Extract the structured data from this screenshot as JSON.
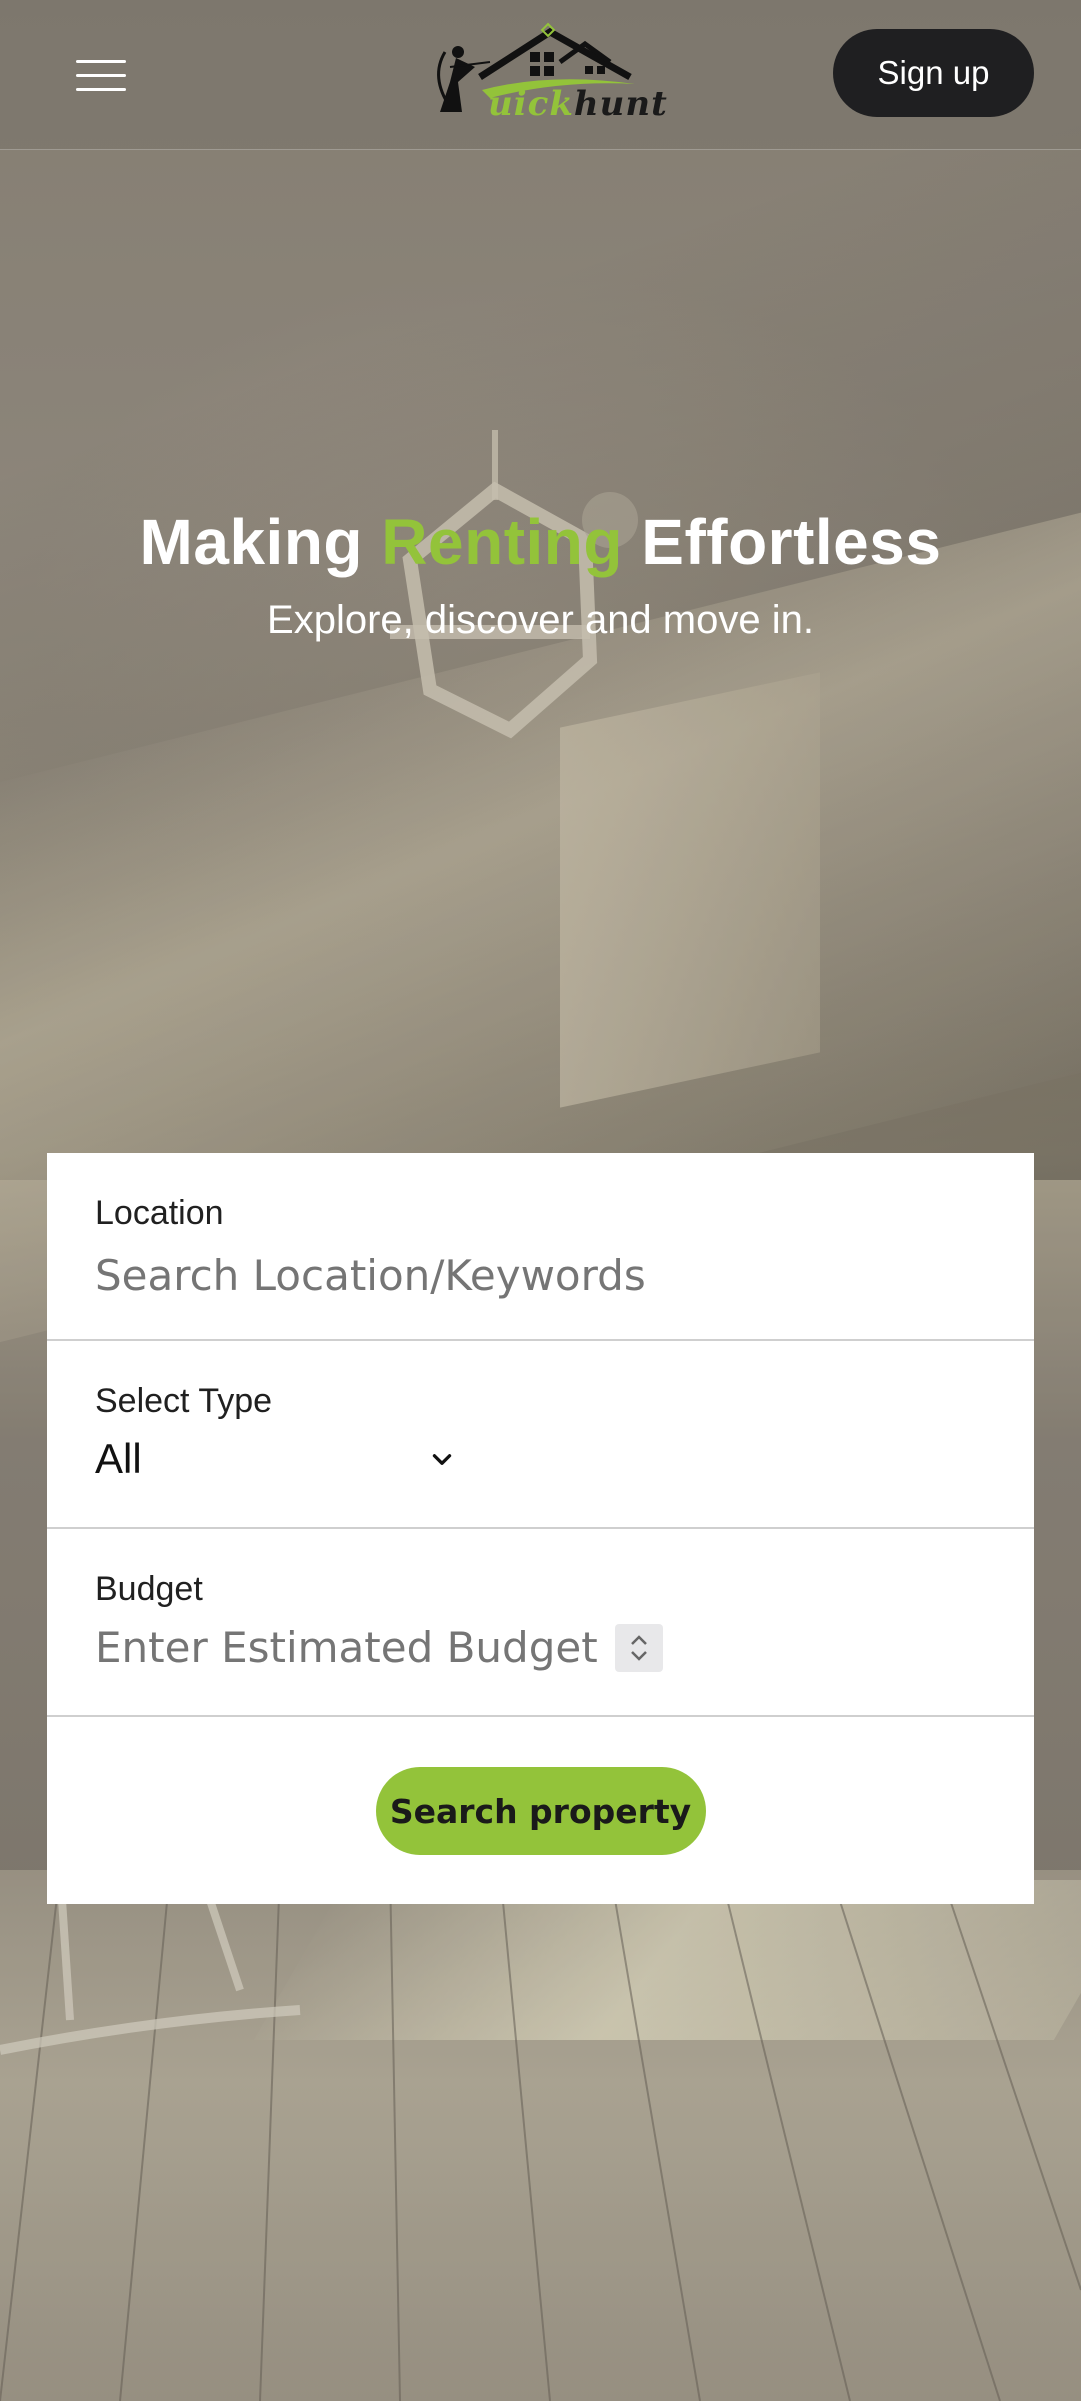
{
  "header": {
    "logo_text_accent": "uick",
    "logo_text_main": "hunt",
    "signup_label": "Sign up"
  },
  "hero": {
    "title_before": "Making ",
    "title_accent": "Renting",
    "title_after": " Effortless",
    "subtitle": "Explore, discover and move in."
  },
  "search": {
    "location_label": "Location",
    "location_placeholder": "Search Location/Keywords",
    "type_label": "Select Type",
    "type_value": "All",
    "budget_label": "Budget",
    "budget_placeholder": "Enter Estimated Budget",
    "button_label": "Search property"
  },
  "colors": {
    "accent": "#93c33a",
    "dark_button": "#1f1f21"
  }
}
